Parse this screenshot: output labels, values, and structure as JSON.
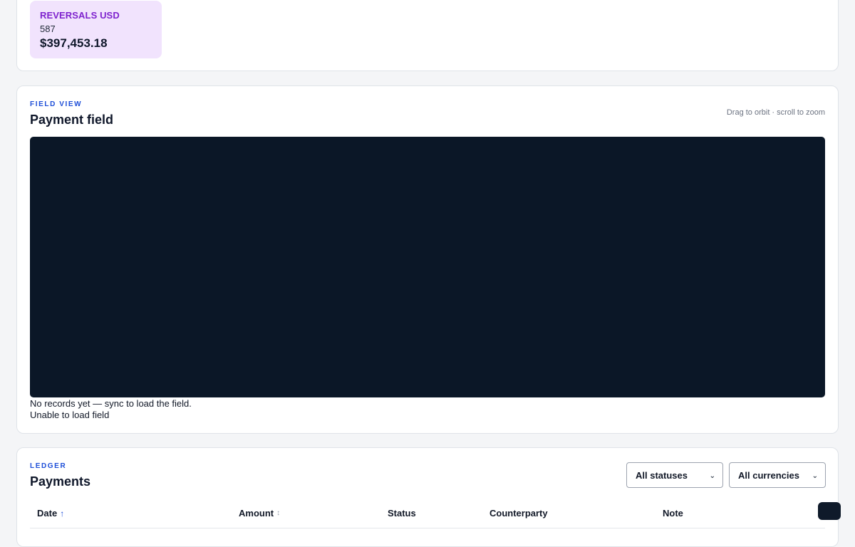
{
  "summary": {
    "tile": {
      "label": "REVERSALS USD",
      "count": "587",
      "amount": "$397,453.18",
      "background": "#f1e3fd",
      "label_color": "#7e22ce"
    }
  },
  "field_view": {
    "eyebrow": "FIELD VIEW",
    "title": "Payment field",
    "hint": "Drag to orbit · scroll to zoom",
    "canvas_color": "#0b1727",
    "empty_message": "No records yet — sync to load the field.",
    "error_message": "Unable to load field"
  },
  "ledger": {
    "eyebrow": "LEDGER",
    "title": "Payments",
    "filters": {
      "status": {
        "selected": "All statuses",
        "icon": "chevron-down-icon"
      },
      "currency": {
        "selected": "All currencies",
        "icon": "chevron-down-icon"
      }
    },
    "columns": [
      {
        "label": "Date",
        "sort_icon": "↑",
        "sort": "ascending"
      },
      {
        "label": "Amount",
        "sort_icon": "↕",
        "sort": "none"
      },
      {
        "label": "Status"
      },
      {
        "label": "Counterparty"
      },
      {
        "label": "Note"
      }
    ]
  },
  "accent_color": "#1d4ed8"
}
